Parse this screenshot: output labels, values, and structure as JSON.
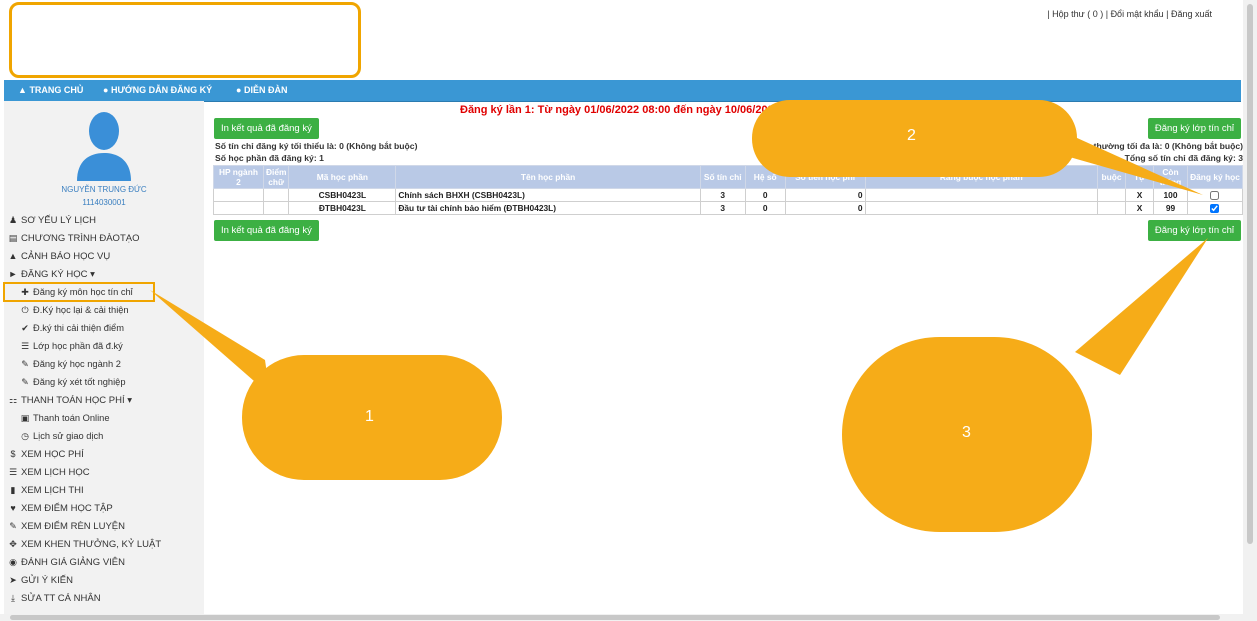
{
  "top_links": {
    "mailbox": "| Hộp thư ( 0 ) |",
    "change_password": "Đổi mật khẩu",
    "separator": "|",
    "logout": "Đăng xuất"
  },
  "nav": {
    "home": "TRANG CHỦ",
    "guide": "HƯỚNG DẪN ĐĂNG KÝ",
    "forum": "DIỄN ĐÀN"
  },
  "user": {
    "name": "NGUYỄN TRUNG ĐỨC",
    "id": "1114030001"
  },
  "menu": {
    "profile": "SƠ YẾU LÝ LỊCH",
    "program": "CHƯƠNG TRÌNH ĐÀOTẠO",
    "warning": "CẢNH BÁO HỌC VỤ",
    "register": "ĐĂNG KÝ HỌC",
    "register_subs": [
      "Đăng ký môn học tín chỉ",
      "Đ.Ký học lại & cải thiện",
      "Đ.ký thi cải thiện điểm",
      "Lớp học phần đã đ.ký",
      "Đăng ký học ngành 2",
      "Đăng ký xét tốt nghiệp"
    ],
    "payment": "THANH TOÁN HỌC PHÍ",
    "payment_subs": [
      "Thanh toán Online",
      "Lịch sử giao dịch"
    ],
    "tuition": "XEM HỌC PHÍ",
    "schedule": "XEM LỊCH HỌC",
    "exam": "XEM LỊCH THI",
    "grades": "XEM ĐIỂM HỌC TẬP",
    "training": "XEM ĐIỂM RÈN LUYỆN",
    "rewards": "XEM KHEN THƯỞNG, KỶ LUẬT",
    "evaluate": "ĐÁNH GIÁ GIẢNG VIÊN",
    "feedback": "GỬI Ý KIẾN",
    "edit_info": "SỬA TT CÁ NHÂN"
  },
  "main": {
    "registration_period": "Đăng ký lần 1: Từ ngày 01/06/2022 08:00 đến ngày 10/06/2022",
    "print_button": "In kết quả đã đăng ký",
    "register_button": "Đăng ký lớp tín chỉ",
    "min_credits": "Số tín chỉ đăng ký tối thiểu là: 0 (Không bắt buộc)",
    "courses_registered": "Số học phần đã đăng ký: 1",
    "max_credits": "thường tối đa là: 0 (Không bắt buộc)",
    "total_credits": "Tổng số tín chỉ đã đăng ký: 3"
  },
  "table": {
    "headers": [
      "HP ngành 2",
      "Điểm chữ",
      "Mã học phần",
      "Tên học phần",
      "Số tín chỉ",
      "Hệ số",
      "Số tiền học phí",
      "Ràng buộc học phần",
      "buộc",
      "Tự",
      "Còn trống",
      "Đăng ký học"
    ],
    "rows": [
      {
        "code": "CSBH0423L",
        "name": "Chính sách BHXH (CSBH0423L)",
        "credits": "3",
        "coef": "0",
        "fee": "0",
        "mark": "X",
        "remaining": "100",
        "checked": false
      },
      {
        "code": "ĐTBH0423L",
        "name": "Đầu tư tài chính bảo hiểm (ĐTBH0423L)",
        "credits": "3",
        "coef": "0",
        "fee": "0",
        "mark": "X",
        "remaining": "99",
        "checked": true
      }
    ]
  },
  "annotations": {
    "one": "1",
    "two": "2",
    "three": "3"
  },
  "colors": {
    "accent": "#f6ac18",
    "nav": "#3a97d4",
    "button": "#3cb043",
    "header": "#b9c9e6",
    "alert": "#e00000"
  }
}
